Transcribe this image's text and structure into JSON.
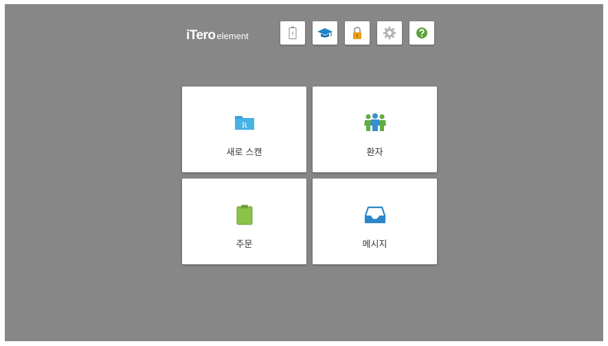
{
  "header": {
    "logo_brand": "iTero",
    "logo_sub": "element",
    "toolbar": [
      {
        "icon": "battery-icon"
      },
      {
        "icon": "graduation-cap-icon"
      },
      {
        "icon": "lock-icon"
      },
      {
        "icon": "gear-icon"
      },
      {
        "icon": "help-icon"
      }
    ]
  },
  "tiles": {
    "new_scan": {
      "label": "새로 스캔",
      "icon": "folder-icon",
      "icon_letter": "R"
    },
    "patients": {
      "label": "환자",
      "icon": "patients-icon"
    },
    "orders": {
      "label": "주문",
      "icon": "clipboard-icon"
    },
    "messages": {
      "label": "메시지",
      "icon": "inbox-icon"
    }
  },
  "colors": {
    "background": "#878787",
    "tile": "#ffffff",
    "folder": "#3aa2d6",
    "patients_green": "#5fae45",
    "patients_blue": "#3a8fcc",
    "clipboard": "#8bc34a",
    "inbox": "#2b88c8",
    "help": "#5da13a",
    "lock": "#e8a020"
  }
}
